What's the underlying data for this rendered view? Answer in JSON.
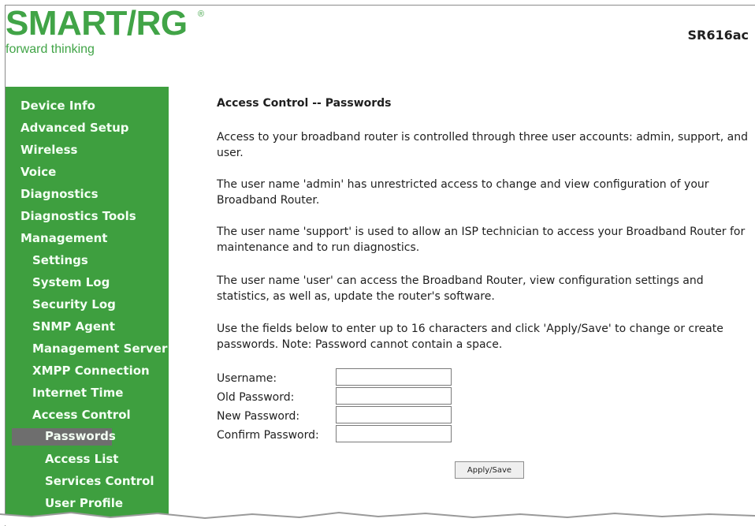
{
  "header": {
    "logo_main": "SMART/RG",
    "logo_registered": "®",
    "logo_tagline": "forward thinking",
    "model": "SR616ac"
  },
  "sidebar": {
    "items": [
      {
        "label": "Device Info",
        "level": 1
      },
      {
        "label": "Advanced Setup",
        "level": 1
      },
      {
        "label": "Wireless",
        "level": 1
      },
      {
        "label": "Voice",
        "level": 1
      },
      {
        "label": "Diagnostics",
        "level": 1
      },
      {
        "label": "Diagnostics Tools",
        "level": 1
      },
      {
        "label": "Management",
        "level": 1
      },
      {
        "label": "Settings",
        "level": 2
      },
      {
        "label": "System Log",
        "level": 2
      },
      {
        "label": "Security Log",
        "level": 2
      },
      {
        "label": "SNMP Agent",
        "level": 2
      },
      {
        "label": "Management Server",
        "level": 2
      },
      {
        "label": "XMPP Connection",
        "level": 2
      },
      {
        "label": "Internet Time",
        "level": 2
      },
      {
        "label": "Access Control",
        "level": 2
      },
      {
        "label": "Passwords",
        "level": 3,
        "selected": true
      },
      {
        "label": "Access List",
        "level": 3
      },
      {
        "label": "Services Control",
        "level": 3
      },
      {
        "label": "User Profile",
        "level": 3
      }
    ]
  },
  "main": {
    "title": "Access Control -- Passwords",
    "paragraphs": [
      "Access to your broadband router is controlled through three user accounts: admin, support, and user.",
      "The user name 'admin' has unrestricted access to change and view configuration of your Broadband Router.",
      "The user name 'support' is used to allow an ISP technician to access your Broadband Router for maintenance and to run diagnostics.",
      "The user name 'user' can access the Broadband Router, view configuration settings and statistics, as well as, update the router's software.",
      "Use the fields below to enter up to 16 characters and click 'Apply/Save' to change or create passwords. Note: Password cannot contain a space."
    ],
    "form": {
      "username_label": "Username:",
      "username_value": "",
      "old_password_label": "Old Password:",
      "old_password_value": "",
      "new_password_label": "New Password:",
      "new_password_value": "",
      "confirm_password_label": "Confirm Password:",
      "confirm_password_value": ""
    },
    "apply_label": "Apply/Save"
  },
  "colors": {
    "brand_green": "#41a447",
    "sidebar_green": "#3e9f3f",
    "selected_bg": "#6e6e6e"
  }
}
